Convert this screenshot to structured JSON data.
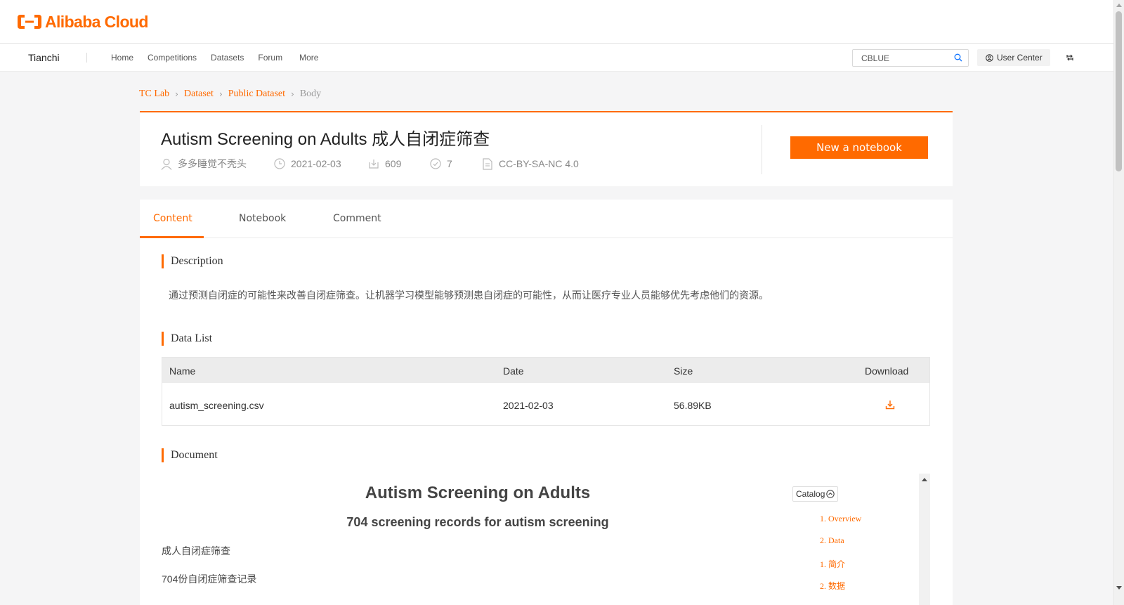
{
  "brand": {
    "logo_text": "Alibaba Cloud",
    "site_name": "Tianchi",
    "accent": "#ff6a00"
  },
  "nav": {
    "links": [
      "Home",
      "Competitions",
      "Datasets",
      "Forum",
      "More"
    ],
    "search_value": "CBLUE",
    "user_center": "User Center"
  },
  "breadcrumb": [
    "TC Lab",
    "Dataset",
    "Public Dataset",
    "Body"
  ],
  "dataset": {
    "title": "Autism Screening on Adults 成人自闭症筛查",
    "author": "多多睡觉不秃头",
    "date": "2021-02-03",
    "downloads": "609",
    "likes": "7",
    "license": "CC-BY-SA-NC 4.0",
    "new_notebook": "New a notebook"
  },
  "tabs": [
    "Content",
    "Notebook",
    "Comment"
  ],
  "sections": {
    "description_title": "Description",
    "description_text": "通过预测自闭症的可能性来改善自闭症筛查。让机器学习模型能够预测患自闭症的可能性，从而让医疗专业人员能够优先考虑他们的资源。",
    "data_list_title": "Data List",
    "document_title": "Document"
  },
  "data_table": {
    "columns": [
      "Name",
      "Date",
      "Size",
      "Download"
    ],
    "rows": [
      {
        "name": "autism_screening.csv",
        "date": "2021-02-03",
        "size": "56.89KB"
      }
    ]
  },
  "document": {
    "h1": "Autism Screening on Adults",
    "h2": "704 screening records for autism screening",
    "p1": "成人自闭症筛查",
    "p2": "704份自闭症筛查记录",
    "catalog_label": "Catalog",
    "catalog_items": [
      "1. Overview",
      "2. Data",
      "1. 简介",
      "2. 数据"
    ]
  }
}
